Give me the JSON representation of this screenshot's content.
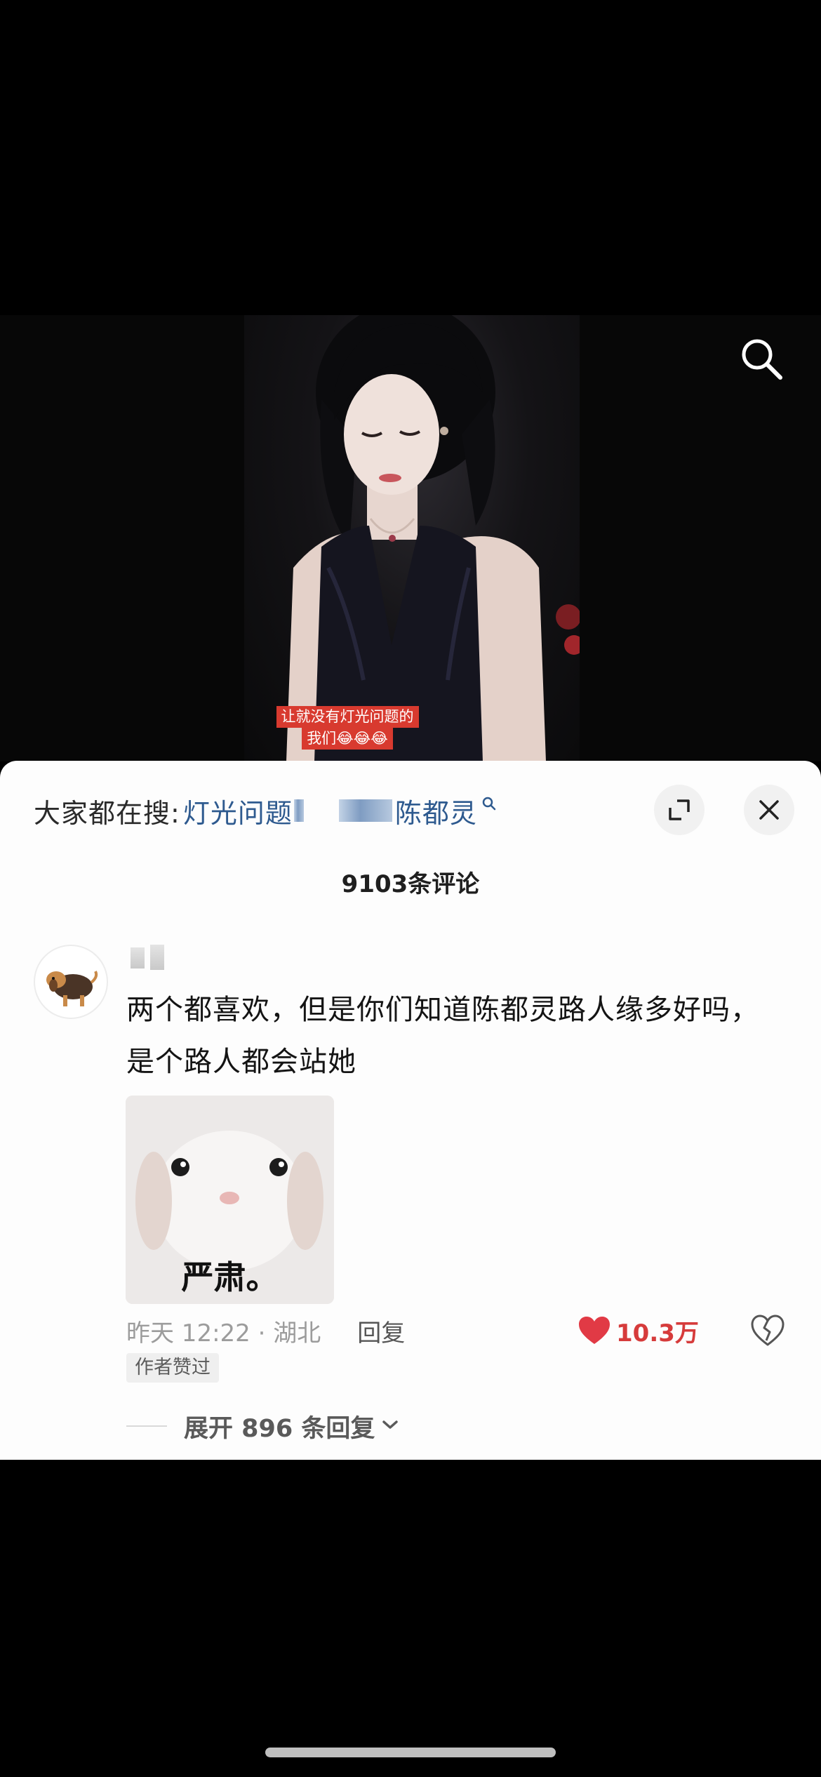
{
  "video": {
    "subtitle_line1": "让就没有灯光问题的",
    "subtitle_line2": "我们😂😂😂",
    "search_icon": "search-icon"
  },
  "panel": {
    "search_prefix": "大家都在搜:",
    "search_term1": "灯光问题",
    "search_term2": "陈都灵",
    "expand_icon": "expand-icon",
    "close_icon": "close-icon",
    "comment_count": "9103条评论"
  },
  "comment": {
    "text": "两个都喜欢，但是你们知道陈都灵路人缘多好吗，是个路人都会站她",
    "sticker_caption": "严肃。",
    "time_location": "昨天 12:22 · 湖北",
    "reply_label": "回复",
    "like_count": "10.3万",
    "author_badge": "作者赞过",
    "expand_replies": "展开 896 条回复"
  },
  "colors": {
    "accent_red": "#d63b3b",
    "search_term_blue": "#2e5a8f",
    "subtitle_bg": "#d83a2f"
  }
}
